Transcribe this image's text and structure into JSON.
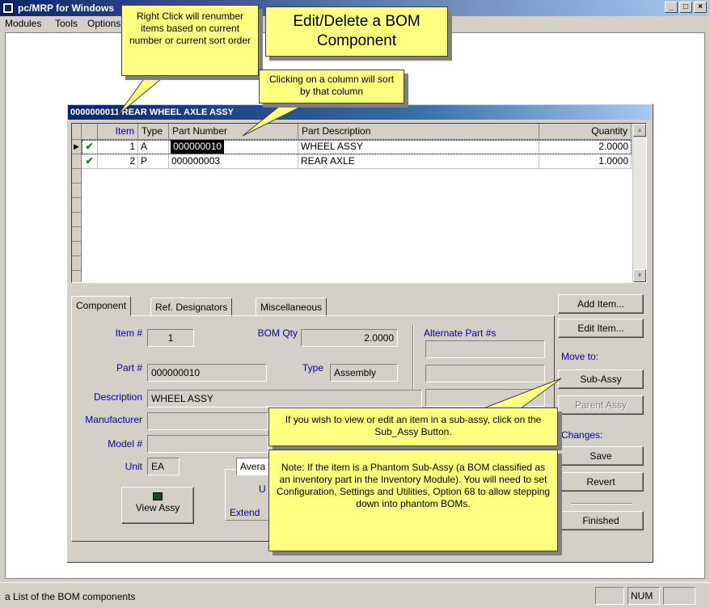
{
  "window": {
    "title": "pc/MRP for Windows",
    "controls": [
      "_",
      "□",
      "×"
    ]
  },
  "menu": [
    "Modules",
    "Tools",
    "Options"
  ],
  "bom_window": {
    "title": "0000000011 REAR WHEEL AXLE ASSY"
  },
  "grid": {
    "columns": [
      "Item",
      "Type",
      "Part Number",
      "Part Description",
      "Quantity"
    ],
    "rows": [
      {
        "item": "1",
        "type": "A",
        "part_number": "000000010",
        "description": "WHEEL ASSY",
        "quantity": "2.0000"
      },
      {
        "item": "2",
        "type": "P",
        "part_number": "000000003",
        "description": "REAR AXLE",
        "quantity": "1.0000"
      }
    ]
  },
  "tabs": [
    "Component",
    "Ref. Designators",
    "Miscellaneous"
  ],
  "form": {
    "item_label": "Item #",
    "item_value": "1",
    "bom_qty_label": "BOM Qty",
    "bom_qty_value": "2.0000",
    "alternate_label": "Alternate Part #s",
    "part_label": "Part #",
    "part_value": "000000010",
    "type_label": "Type",
    "type_value": "Assembly",
    "description_label": "Description",
    "description_value": "WHEEL ASSY",
    "manufacturer_label": "Manufacturer",
    "model_label": "Model #",
    "unit_label": "Unit",
    "unit_value": "EA",
    "cost_select": "Avera",
    "u_label": "U",
    "extend_label": "Extend",
    "view_assy": "View Assy"
  },
  "buttons": {
    "add_item": "Add Item...",
    "edit_item": "Edit Item...",
    "move_to": "Move to:",
    "sub_assy": "Sub-Assy",
    "parent_assy": "Parent Assy",
    "changes": "Changes:",
    "save": "Save",
    "revert": "Revert",
    "finished": "Finished"
  },
  "callouts": {
    "renumber": "Right Click will renumber items based on current number or current sort order",
    "title": "Edit/Delete a BOM Component",
    "sort": "Clicking on a column will sort by that column",
    "subassy": "If you wish to view or edit an item in a sub-assy, click on the Sub_Assy Button.",
    "phantom": "Note: If the item is a Phantom Sub-Assy (a BOM classified as an inventory part in the Inventory Module). You will need to set Configuration, Settings and Utilities, Option 68 to allow stepping down into phantom BOMs."
  },
  "status": {
    "text": "a List of the BOM components",
    "num": "NUM"
  },
  "colors": {
    "titlebar": "#0a246a",
    "callout": "#ffff80",
    "face": "#d4d0c8",
    "check": "#1a7f1a"
  }
}
